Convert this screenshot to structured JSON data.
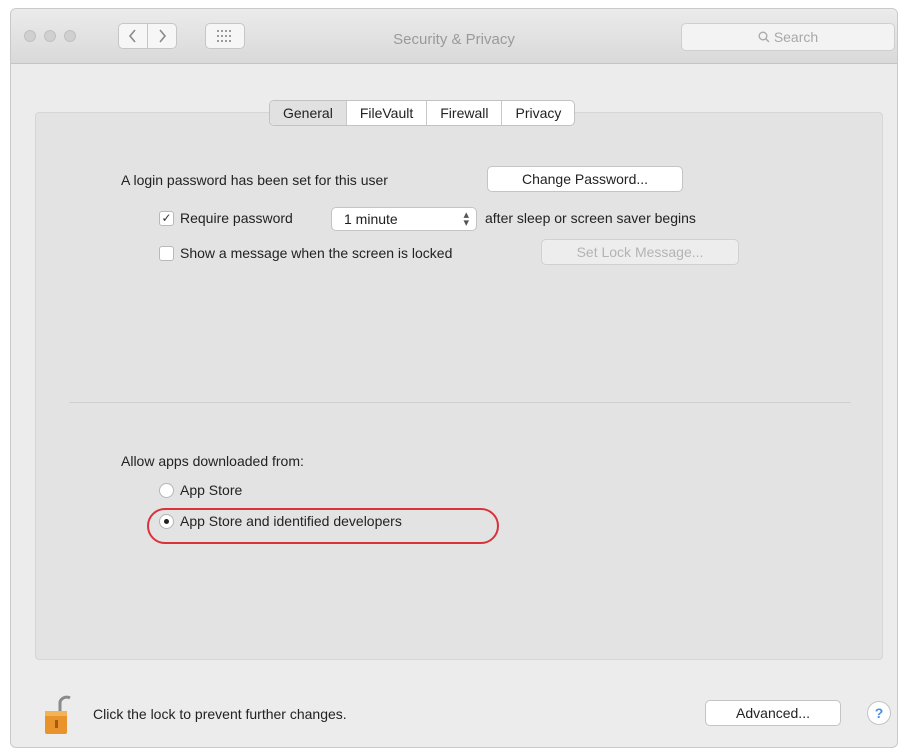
{
  "window": {
    "title": "Security & Privacy"
  },
  "toolbar": {
    "back_icon": "chevron-left-icon",
    "forward_icon": "chevron-right-icon",
    "grid_icon": "show-all-grid-icon",
    "search_placeholder": "Search",
    "search_icon": "magnifier-icon"
  },
  "tabs": [
    {
      "label": "General",
      "selected": true
    },
    {
      "label": "FileVault",
      "selected": false
    },
    {
      "label": "Firewall",
      "selected": false
    },
    {
      "label": "Privacy",
      "selected": false
    }
  ],
  "general": {
    "login_text": "A login password has been set for this user",
    "change_password_label": "Change Password...",
    "require_password": {
      "checked": true,
      "label": "Require password",
      "select_value": "1 minute",
      "suffix": "after sleep or screen saver begins"
    },
    "show_message": {
      "checked": false,
      "label": "Show a message when the screen is locked",
      "button_label": "Set Lock Message..."
    },
    "allow_apps": {
      "heading": "Allow apps downloaded from:",
      "options": [
        {
          "label": "App Store",
          "selected": false
        },
        {
          "label": "App Store and identified developers",
          "selected": true
        }
      ],
      "highlight_color": "#d8333b"
    }
  },
  "footer": {
    "lock_text": "Click the lock to prevent further changes.",
    "lock_icon": "unlocked-padlock-icon",
    "advanced_label": "Advanced...",
    "help_label": "?"
  },
  "colors": {
    "lock_body": "#e8932b",
    "help_blue": "#4a90e2"
  }
}
